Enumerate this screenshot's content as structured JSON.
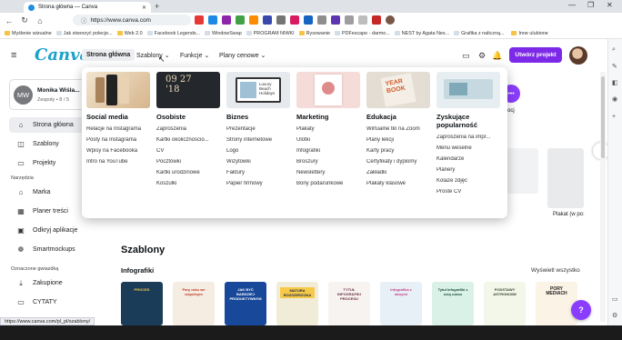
{
  "browser": {
    "tab_title": "Strona główna — Canva",
    "new_tab": "+",
    "window_controls": [
      "—",
      "❐",
      "✕"
    ],
    "url": "https://www.canva.com",
    "nav_icons": [
      "←",
      "↻",
      "⌂",
      "ⓘ"
    ]
  },
  "bookmarks": [
    {
      "label": "Myślenie wizualne",
      "icon": "folder-icon"
    },
    {
      "label": "Jak stworzyć polecje...",
      "icon": "page-icon"
    },
    {
      "label": "Web 2.0",
      "icon": "folder-icon"
    },
    {
      "label": "Facebook Legends...",
      "icon": "page-icon"
    },
    {
      "label": "WindowSwap",
      "icon": "page-icon"
    },
    {
      "label": "PROGRAM NIWKI",
      "icon": "page-icon"
    },
    {
      "label": "Rysowanie",
      "icon": "folder-icon"
    },
    {
      "label": "PDFescape - darmo...",
      "icon": "page-icon"
    },
    {
      "label": "NEST by Agata Nes...",
      "icon": "page-icon"
    },
    {
      "label": "Grafika z naliczną...",
      "icon": "page-icon"
    },
    {
      "label": "Inne ulubione",
      "icon": "folder-icon"
    }
  ],
  "header": {
    "logo": "Canva",
    "menu_icon": "≡",
    "nav": [
      {
        "label": "Strona główna",
        "active": true
      },
      {
        "label": "Szablony ⌄",
        "active": false
      },
      {
        "label": "Funkcje ⌄",
        "active": false
      },
      {
        "label": "Plany cenowe ⌄",
        "active": false
      }
    ],
    "icons": [
      "▭",
      "⚙",
      "🔔"
    ],
    "create_button": "Utwórz projekt"
  },
  "sidebar": {
    "profile": {
      "initials": "MW",
      "name": "Monika Wiśla...",
      "sub": "Zespoły • 8 / 5"
    },
    "items": [
      {
        "label": "Strona główna",
        "icon": "⌂",
        "active": true
      },
      {
        "label": "Szablony",
        "icon": "◫",
        "active": false
      },
      {
        "label": "Projekty",
        "icon": "▭",
        "active": false
      }
    ],
    "section_tools": "Narzędzia",
    "tools": [
      {
        "label": "Marka",
        "icon": "⌂"
      },
      {
        "label": "Planer treści",
        "icon": "▦"
      },
      {
        "label": "Odkryj aplikacje",
        "icon": "▣"
      },
      {
        "label": "Smartmockups",
        "icon": "❁"
      }
    ],
    "section_starred": "Oznaczone gwiazdką",
    "starred": [
      {
        "label": "Zakupione",
        "icon": "⤓"
      },
      {
        "label": "CYTATY",
        "icon": "▭"
      }
    ]
  },
  "status_url": "https://www.canva.com/pl_pl/szablony/",
  "dropdown": {
    "columns": [
      {
        "title": "Social media",
        "links": [
          "Relacje na Instagrama",
          "Posty na Instagrama",
          "Wpisy na Facebooka",
          "Intro na YouTube"
        ]
      },
      {
        "title": "Osobiste",
        "links": [
          "Zaproszenia",
          "Kartki okolicznościo...",
          "CV",
          "Pocztówki",
          "Kartki urodzinowe",
          "Koszulki"
        ]
      },
      {
        "title": "Biznes",
        "links": [
          "Prezentacje",
          "Strony internetowe",
          "Logo",
          "Wizytówki",
          "Faktury",
          "Papier firmowy"
        ]
      },
      {
        "title": "Marketing",
        "links": [
          "Plakaty",
          "Ulotki",
          "Infografiki",
          "Broszury",
          "Newslettery",
          "Bony podarunkowe"
        ]
      },
      {
        "title": "Edukacja",
        "links": [
          "Wirtualne tło na Zoom",
          "Plany lekcji",
          "Karty pracy",
          "Certyfikaty i dyplomy",
          "Zakładki",
          "Plakaty klasowe"
        ]
      },
      {
        "title": "Zyskujące popularność",
        "links": [
          "Zaproszenia na impr...",
          "Menu weselne",
          "Kalendarze",
          "Planery",
          "Kolaże zdjęć",
          "Proste CV"
        ]
      }
    ],
    "image_texts": {
      "osobiste_date": "09 27 '18",
      "biznes": "Luxury Beach Holidays",
      "edukacja": "YEAR BOOK"
    }
  },
  "main": {
    "section_title": "Szablony",
    "subsection": "Infografiki",
    "see_all": "Wyświetl wszystko",
    "plakat_label": "Plakat (w po:",
    "purple_circle": "•••",
    "next_arrow": "›",
    "partial_text": "ocj",
    "thumbnails": [
      {
        "text": "PROCES",
        "bg": "#1a3c58",
        "fg": "#f7c948"
      },
      {
        "text": "Pary roku we wspólnym",
        "bg": "#f5ede1",
        "fg": "#c0392b"
      },
      {
        "text": "JAK BYĆ BARDZIEJ PRODUKTYWNYM",
        "bg": "#17489a",
        "fg": "#ffffff"
      },
      {
        "text": "MATURA ROZSZERZONA",
        "bg": "#f0ecd8",
        "fg": "#1b2a4a"
      },
      {
        "text": "TYTUŁ INFOGRAFIKI PROCESU",
        "bg": "#f7f3f0",
        "fg": "#6b2e49"
      },
      {
        "text": "Infografika z danymi",
        "bg": "#e7f0f7",
        "fg": "#c6418a"
      },
      {
        "text": "Tytuł infografiki z osią czasu",
        "bg": "#d9f1e6",
        "fg": "#1d4d3a"
      },
      {
        "text": "PODSTAWY ASTRONOMII",
        "bg": "#f3f7ea",
        "fg": "#39452b"
      },
      {
        "text": "PORY MEDIACH",
        "bg": "#fbf3e6",
        "fg": "#222222"
      }
    ],
    "help": "?"
  },
  "colors": {
    "accent": "#7d2ae8",
    "canva_blue": "#1ba1c9",
    "outer_bg": "#2ec4c4"
  }
}
